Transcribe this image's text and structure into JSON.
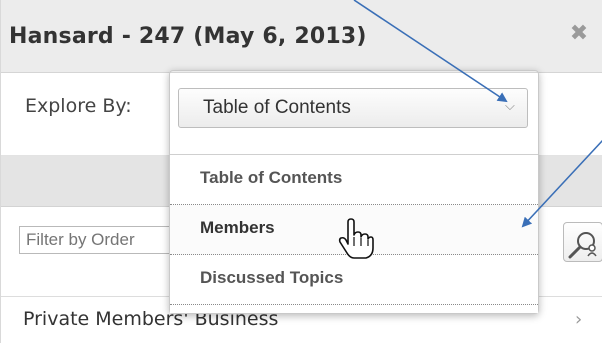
{
  "panel": {
    "title": "Hansard - 247 (May 6, 2013)",
    "close_icon": "close-icon"
  },
  "explore": {
    "label": "Explore By:",
    "selected": "Table of Contents"
  },
  "menu": {
    "items": [
      {
        "label": "Table of Contents"
      },
      {
        "label": "Members"
      },
      {
        "label": "Discussed Topics"
      }
    ]
  },
  "filter": {
    "placeholder": "Filter by Order"
  },
  "section": {
    "label": "Private Members' Business"
  },
  "colors": {
    "header_bg": "#ececec",
    "annotation_arrow": "#3a6fb7",
    "menu_text": "#555555"
  }
}
